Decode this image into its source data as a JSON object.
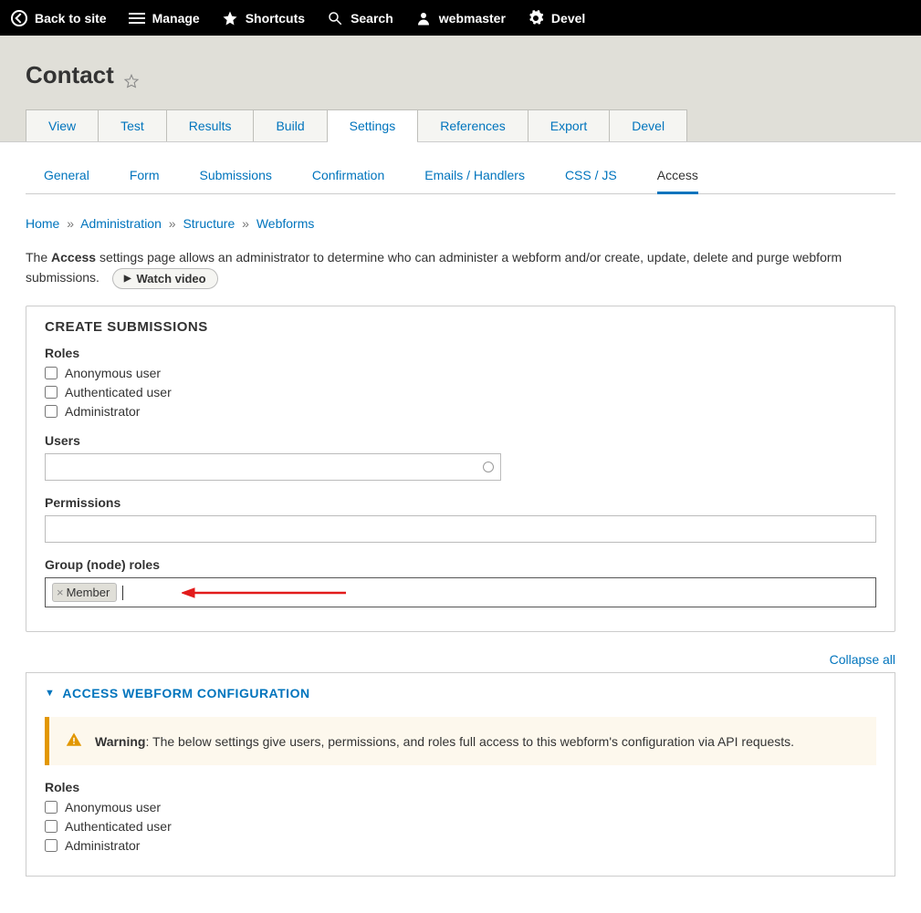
{
  "toolbar": {
    "back": "Back to site",
    "manage": "Manage",
    "shortcuts": "Shortcuts",
    "search": "Search",
    "user": "webmaster",
    "devel": "Devel"
  },
  "page": {
    "title": "Contact"
  },
  "primary_tabs": {
    "view": "View",
    "test": "Test",
    "results": "Results",
    "build": "Build",
    "settings": "Settings",
    "references": "References",
    "export": "Export",
    "devel": "Devel"
  },
  "secondary_tabs": {
    "general": "General",
    "form": "Form",
    "submissions": "Submissions",
    "confirmation": "Confirmation",
    "emails": "Emails / Handlers",
    "cssjs": "CSS / JS",
    "access": "Access"
  },
  "breadcrumb": {
    "home": "Home",
    "admin": "Administration",
    "structure": "Structure",
    "webforms": "Webforms",
    "sep": "»"
  },
  "intro": {
    "pre": "The ",
    "strong": "Access",
    "post": " settings page allows an administrator to determine who can administer a webform and/or create, update, delete and purge webform submissions.",
    "watch": "Watch video"
  },
  "create": {
    "legend": "CREATE SUBMISSIONS",
    "roles_label": "Roles",
    "anon": "Anonymous user",
    "auth": "Authenticated user",
    "admin": "Administrator",
    "users_label": "Users",
    "perm_label": "Permissions",
    "group_label": "Group (node) roles",
    "member_tag": "Member"
  },
  "collapse_all": "Collapse all",
  "access_config": {
    "summary": "ACCESS WEBFORM CONFIGURATION",
    "warning_label": "Warning",
    "warning_text": ": The below settings give users, permissions, and roles full access to this webform's configuration via API requests.",
    "roles_label": "Roles",
    "anon": "Anonymous user",
    "auth": "Authenticated user",
    "admin": "Administrator"
  }
}
